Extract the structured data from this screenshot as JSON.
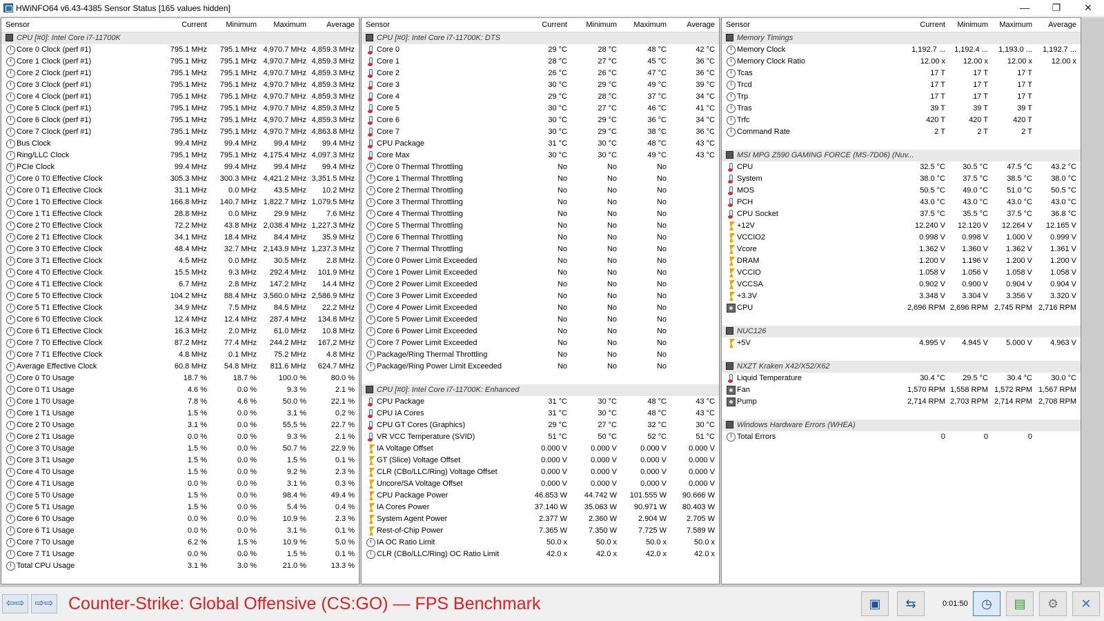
{
  "window": {
    "title": "HWiNFO64 v6.43-4385 Sensor Status [165 values hidden]",
    "min": "—",
    "max": "❐",
    "close": "✕"
  },
  "headers": {
    "sensor": "Sensor",
    "current": "Current",
    "minimum": "Minimum",
    "maximum": "Maximum",
    "average": "Average"
  },
  "pane1": [
    {
      "t": "g",
      "n": "CPU [#0]: Intel Core i7-11700K"
    },
    {
      "i": "clock",
      "n": "Core 0 Clock (perf #1)",
      "c": "795.1 MHz",
      "mi": "795.1 MHz",
      "ma": "4,970.7 MHz",
      "a": "4,859.3 MHz"
    },
    {
      "i": "clock",
      "n": "Core 1 Clock (perf #1)",
      "c": "795.1 MHz",
      "mi": "795.1 MHz",
      "ma": "4,970.7 MHz",
      "a": "4,859.3 MHz"
    },
    {
      "i": "clock",
      "n": "Core 2 Clock (perf #1)",
      "c": "795.1 MHz",
      "mi": "795.1 MHz",
      "ma": "4,970.7 MHz",
      "a": "4,859.3 MHz"
    },
    {
      "i": "clock",
      "n": "Core 3 Clock (perf #1)",
      "c": "795.1 MHz",
      "mi": "795.1 MHz",
      "ma": "4,970.7 MHz",
      "a": "4,859.3 MHz"
    },
    {
      "i": "clock",
      "n": "Core 4 Clock (perf #1)",
      "c": "795.1 MHz",
      "mi": "795.1 MHz",
      "ma": "4,970.7 MHz",
      "a": "4,859.3 MHz"
    },
    {
      "i": "clock",
      "n": "Core 5 Clock (perf #1)",
      "c": "795.1 MHz",
      "mi": "795.1 MHz",
      "ma": "4,970.7 MHz",
      "a": "4,859.3 MHz"
    },
    {
      "i": "clock",
      "n": "Core 6 Clock (perf #1)",
      "c": "795.1 MHz",
      "mi": "795.1 MHz",
      "ma": "4,970.7 MHz",
      "a": "4,859.3 MHz"
    },
    {
      "i": "clock",
      "n": "Core 7 Clock (perf #1)",
      "c": "795.1 MHz",
      "mi": "795.1 MHz",
      "ma": "4,970.7 MHz",
      "a": "4,863.8 MHz"
    },
    {
      "i": "clock",
      "n": "Bus Clock",
      "c": "99.4 MHz",
      "mi": "99.4 MHz",
      "ma": "99.4 MHz",
      "a": "99.4 MHz"
    },
    {
      "i": "clock",
      "n": "Ring/LLC Clock",
      "c": "795.1 MHz",
      "mi": "795.1 MHz",
      "ma": "4,175.4 MHz",
      "a": "4,097.3 MHz"
    },
    {
      "i": "clock",
      "n": "PCIe Clock",
      "c": "99.4 MHz",
      "mi": "99.4 MHz",
      "ma": "99.4 MHz",
      "a": "99.4 MHz"
    },
    {
      "i": "clock",
      "n": "Core 0 T0 Effective Clock",
      "c": "305.3 MHz",
      "mi": "300.3 MHz",
      "ma": "4,421.2 MHz",
      "a": "3,351.5 MHz"
    },
    {
      "i": "clock",
      "n": "Core 0 T1 Effective Clock",
      "c": "31.1 MHz",
      "mi": "0.0 MHz",
      "ma": "43.5 MHz",
      "a": "10.2 MHz"
    },
    {
      "i": "clock",
      "n": "Core 1 T0 Effective Clock",
      "c": "166.8 MHz",
      "mi": "140.7 MHz",
      "ma": "1,822.7 MHz",
      "a": "1,079.5 MHz"
    },
    {
      "i": "clock",
      "n": "Core 1 T1 Effective Clock",
      "c": "28.8 MHz",
      "mi": "0.0 MHz",
      "ma": "29.9 MHz",
      "a": "7.6 MHz"
    },
    {
      "i": "clock",
      "n": "Core 2 T0 Effective Clock",
      "c": "72.2 MHz",
      "mi": "43.8 MHz",
      "ma": "2,038.4 MHz",
      "a": "1,227.3 MHz"
    },
    {
      "i": "clock",
      "n": "Core 2 T1 Effective Clock",
      "c": "34.1 MHz",
      "mi": "18.4 MHz",
      "ma": "84.4 MHz",
      "a": "35.9 MHz"
    },
    {
      "i": "clock",
      "n": "Core 3 T0 Effective Clock",
      "c": "48.4 MHz",
      "mi": "32.7 MHz",
      "ma": "2,143.9 MHz",
      "a": "1,237.3 MHz"
    },
    {
      "i": "clock",
      "n": "Core 3 T1 Effective Clock",
      "c": "4.5 MHz",
      "mi": "0.0 MHz",
      "ma": "30.5 MHz",
      "a": "2.8 MHz"
    },
    {
      "i": "clock",
      "n": "Core 4 T0 Effective Clock",
      "c": "15.5 MHz",
      "mi": "9.3 MHz",
      "ma": "292.4 MHz",
      "a": "101.9 MHz"
    },
    {
      "i": "clock",
      "n": "Core 4 T1 Effective Clock",
      "c": "6.7 MHz",
      "mi": "2.8 MHz",
      "ma": "147.2 MHz",
      "a": "14.4 MHz"
    },
    {
      "i": "clock",
      "n": "Core 5 T0 Effective Clock",
      "c": "104.2 MHz",
      "mi": "88.4 MHz",
      "ma": "3,560.0 MHz",
      "a": "2,586.9 MHz"
    },
    {
      "i": "clock",
      "n": "Core 5 T1 Effective Clock",
      "c": "34.9 MHz",
      "mi": "7.5 MHz",
      "ma": "84.5 MHz",
      "a": "22.2 MHz"
    },
    {
      "i": "clock",
      "n": "Core 6 T0 Effective Clock",
      "c": "12.4 MHz",
      "mi": "12.4 MHz",
      "ma": "287.4 MHz",
      "a": "134.8 MHz"
    },
    {
      "i": "clock",
      "n": "Core 6 T1 Effective Clock",
      "c": "16.3 MHz",
      "mi": "2.0 MHz",
      "ma": "61.0 MHz",
      "a": "10.8 MHz"
    },
    {
      "i": "clock",
      "n": "Core 7 T0 Effective Clock",
      "c": "87.2 MHz",
      "mi": "77.4 MHz",
      "ma": "244.2 MHz",
      "a": "167.2 MHz"
    },
    {
      "i": "clock",
      "n": "Core 7 T1 Effective Clock",
      "c": "4.8 MHz",
      "mi": "0.1 MHz",
      "ma": "75.2 MHz",
      "a": "4.8 MHz"
    },
    {
      "i": "clock",
      "n": "Average Effective Clock",
      "c": "60.8 MHz",
      "mi": "54.8 MHz",
      "ma": "811.6 MHz",
      "a": "624.7 MHz"
    },
    {
      "i": "clock",
      "n": "Core 0 T0 Usage",
      "c": "18.7 %",
      "mi": "18.7 %",
      "ma": "100.0 %",
      "a": "80.0 %"
    },
    {
      "i": "clock",
      "n": "Core 0 T1 Usage",
      "c": "4.6 %",
      "mi": "0.0 %",
      "ma": "9.3 %",
      "a": "2.1 %"
    },
    {
      "i": "clock",
      "n": "Core 1 T0 Usage",
      "c": "7.8 %",
      "mi": "4.6 %",
      "ma": "50.0 %",
      "a": "22.1 %"
    },
    {
      "i": "clock",
      "n": "Core 1 T1 Usage",
      "c": "1.5 %",
      "mi": "0.0 %",
      "ma": "3.1 %",
      "a": "0.2 %"
    },
    {
      "i": "clock",
      "n": "Core 2 T0 Usage",
      "c": "3.1 %",
      "mi": "0.0 %",
      "ma": "55.5 %",
      "a": "22.7 %"
    },
    {
      "i": "clock",
      "n": "Core 2 T1 Usage",
      "c": "0.0 %",
      "mi": "0.0 %",
      "ma": "9.3 %",
      "a": "2.1 %"
    },
    {
      "i": "clock",
      "n": "Core 3 T0 Usage",
      "c": "1.5 %",
      "mi": "0.0 %",
      "ma": "50.7 %",
      "a": "22.9 %"
    },
    {
      "i": "clock",
      "n": "Core 3 T1 Usage",
      "c": "1.5 %",
      "mi": "0.0 %",
      "ma": "1.5 %",
      "a": "0.1 %"
    },
    {
      "i": "clock",
      "n": "Core 4 T0 Usage",
      "c": "1.5 %",
      "mi": "0.0 %",
      "ma": "9.2 %",
      "a": "2.3 %"
    },
    {
      "i": "clock",
      "n": "Core 4 T1 Usage",
      "c": "0.0 %",
      "mi": "0.0 %",
      "ma": "3.1 %",
      "a": "0.3 %"
    },
    {
      "i": "clock",
      "n": "Core 5 T0 Usage",
      "c": "1.5 %",
      "mi": "0.0 %",
      "ma": "98.4 %",
      "a": "49.4 %"
    },
    {
      "i": "clock",
      "n": "Core 5 T1 Usage",
      "c": "1.5 %",
      "mi": "0.0 %",
      "ma": "5.4 %",
      "a": "0.4 %"
    },
    {
      "i": "clock",
      "n": "Core 6 T0 Usage",
      "c": "0.0 %",
      "mi": "0.0 %",
      "ma": "10.9 %",
      "a": "2.3 %"
    },
    {
      "i": "clock",
      "n": "Core 6 T1 Usage",
      "c": "0.0 %",
      "mi": "0.0 %",
      "ma": "3.1 %",
      "a": "0.1 %"
    },
    {
      "i": "clock",
      "n": "Core 7 T0 Usage",
      "c": "6.2 %",
      "mi": "1.5 %",
      "ma": "10.9 %",
      "a": "5.0 %"
    },
    {
      "i": "clock",
      "n": "Core 7 T1 Usage",
      "c": "0.0 %",
      "mi": "0.0 %",
      "ma": "1.5 %",
      "a": "0.1 %"
    },
    {
      "i": "clock",
      "n": "Total CPU Usage",
      "c": "3.1 %",
      "mi": "3.0 %",
      "ma": "21.0 %",
      "a": "13.3 %"
    }
  ],
  "pane2": [
    {
      "t": "g",
      "n": "CPU [#0]: Intel Core i7-11700K: DTS"
    },
    {
      "i": "therm",
      "n": "Core 0",
      "c": "29 °C",
      "mi": "28 °C",
      "ma": "48 °C",
      "a": "42 °C"
    },
    {
      "i": "therm",
      "n": "Core 1",
      "c": "28 °C",
      "mi": "27 °C",
      "ma": "45 °C",
      "a": "36 °C"
    },
    {
      "i": "therm",
      "n": "Core 2",
      "c": "26 °C",
      "mi": "26 °C",
      "ma": "47 °C",
      "a": "36 °C"
    },
    {
      "i": "therm",
      "n": "Core 3",
      "c": "30 °C",
      "mi": "29 °C",
      "ma": "49 °C",
      "a": "39 °C"
    },
    {
      "i": "therm",
      "n": "Core 4",
      "c": "29 °C",
      "mi": "28 °C",
      "ma": "37 °C",
      "a": "34 °C"
    },
    {
      "i": "therm",
      "n": "Core 5",
      "c": "30 °C",
      "mi": "27 °C",
      "ma": "46 °C",
      "a": "41 °C"
    },
    {
      "i": "therm",
      "n": "Core 6",
      "c": "30 °C",
      "mi": "29 °C",
      "ma": "36 °C",
      "a": "34 °C"
    },
    {
      "i": "therm",
      "n": "Core 7",
      "c": "30 °C",
      "mi": "29 °C",
      "ma": "38 °C",
      "a": "36 °C"
    },
    {
      "i": "therm",
      "n": "CPU Package",
      "c": "31 °C",
      "mi": "30 °C",
      "ma": "48 °C",
      "a": "43 °C"
    },
    {
      "i": "therm",
      "n": "Core Max",
      "c": "30 °C",
      "mi": "30 °C",
      "ma": "49 °C",
      "a": "43 °C"
    },
    {
      "i": "clock",
      "n": "Core 0 Thermal Throttling",
      "c": "No",
      "mi": "No",
      "ma": "No",
      "a": ""
    },
    {
      "i": "clock",
      "n": "Core 1 Thermal Throttling",
      "c": "No",
      "mi": "No",
      "ma": "No",
      "a": ""
    },
    {
      "i": "clock",
      "n": "Core 2 Thermal Throttling",
      "c": "No",
      "mi": "No",
      "ma": "No",
      "a": ""
    },
    {
      "i": "clock",
      "n": "Core 3 Thermal Throttling",
      "c": "No",
      "mi": "No",
      "ma": "No",
      "a": ""
    },
    {
      "i": "clock",
      "n": "Core 4 Thermal Throttling",
      "c": "No",
      "mi": "No",
      "ma": "No",
      "a": ""
    },
    {
      "i": "clock",
      "n": "Core 5 Thermal Throttling",
      "c": "No",
      "mi": "No",
      "ma": "No",
      "a": ""
    },
    {
      "i": "clock",
      "n": "Core 6 Thermal Throttling",
      "c": "No",
      "mi": "No",
      "ma": "No",
      "a": ""
    },
    {
      "i": "clock",
      "n": "Core 7 Thermal Throttling",
      "c": "No",
      "mi": "No",
      "ma": "No",
      "a": ""
    },
    {
      "i": "clock",
      "n": "Core 0 Power Limit Exceeded",
      "c": "No",
      "mi": "No",
      "ma": "No",
      "a": ""
    },
    {
      "i": "clock",
      "n": "Core 1 Power Limit Exceeded",
      "c": "No",
      "mi": "No",
      "ma": "No",
      "a": ""
    },
    {
      "i": "clock",
      "n": "Core 2 Power Limit Exceeded",
      "c": "No",
      "mi": "No",
      "ma": "No",
      "a": ""
    },
    {
      "i": "clock",
      "n": "Core 3 Power Limit Exceeded",
      "c": "No",
      "mi": "No",
      "ma": "No",
      "a": ""
    },
    {
      "i": "clock",
      "n": "Core 4 Power Limit Exceeded",
      "c": "No",
      "mi": "No",
      "ma": "No",
      "a": ""
    },
    {
      "i": "clock",
      "n": "Core 5 Power Limit Exceeded",
      "c": "No",
      "mi": "No",
      "ma": "No",
      "a": ""
    },
    {
      "i": "clock",
      "n": "Core 6 Power Limit Exceeded",
      "c": "No",
      "mi": "No",
      "ma": "No",
      "a": ""
    },
    {
      "i": "clock",
      "n": "Core 7 Power Limit Exceeded",
      "c": "No",
      "mi": "No",
      "ma": "No",
      "a": ""
    },
    {
      "i": "clock",
      "n": "Package/Ring Thermal Throttling",
      "c": "No",
      "mi": "No",
      "ma": "No",
      "a": ""
    },
    {
      "i": "clock",
      "n": "Package/Ring Power Limit Exceeded",
      "c": "No",
      "mi": "No",
      "ma": "No",
      "a": ""
    },
    {
      "t": "s"
    },
    {
      "t": "g",
      "n": "CPU [#0]: Intel Core i7-11700K: Enhanced"
    },
    {
      "i": "therm",
      "n": "CPU Package",
      "c": "31 °C",
      "mi": "30 °C",
      "ma": "48 °C",
      "a": "43 °C"
    },
    {
      "i": "therm",
      "n": "CPU IA Cores",
      "c": "31 °C",
      "mi": "30 °C",
      "ma": "48 °C",
      "a": "43 °C"
    },
    {
      "i": "therm",
      "n": "CPU GT Cores (Graphics)",
      "c": "29 °C",
      "mi": "27 °C",
      "ma": "32 °C",
      "a": "30 °C"
    },
    {
      "i": "therm",
      "n": "VR VCC Temperature (SVID)",
      "c": "51 °C",
      "mi": "50 °C",
      "ma": "52 °C",
      "a": "51 °C"
    },
    {
      "i": "volt",
      "n": "IA Voltage Offset",
      "c": "0.000 V",
      "mi": "0.000 V",
      "ma": "0.000 V",
      "a": "0.000 V"
    },
    {
      "i": "volt",
      "n": "GT (Slice) Voltage Offset",
      "c": "0.000 V",
      "mi": "0.000 V",
      "ma": "0.000 V",
      "a": "0.000 V"
    },
    {
      "i": "volt",
      "n": "CLR (CBo/LLC/Ring) Voltage Offset",
      "c": "0.000 V",
      "mi": "0.000 V",
      "ma": "0.000 V",
      "a": "0.000 V"
    },
    {
      "i": "volt",
      "n": "Uncore/SA Voltage Offset",
      "c": "0.000 V",
      "mi": "0.000 V",
      "ma": "0.000 V",
      "a": "0.000 V"
    },
    {
      "i": "volt",
      "n": "CPU Package Power",
      "c": "46.853 W",
      "mi": "44.742 W",
      "ma": "101.555 W",
      "a": "90.666 W"
    },
    {
      "i": "volt",
      "n": "IA Cores Power",
      "c": "37.140 W",
      "mi": "35.063 W",
      "ma": "90.971 W",
      "a": "80.403 W"
    },
    {
      "i": "volt",
      "n": "System Agent Power",
      "c": "2.377 W",
      "mi": "2.360 W",
      "ma": "2.904 W",
      "a": "2.705 W"
    },
    {
      "i": "volt",
      "n": "Rest-of-Chip Power",
      "c": "7.365 W",
      "mi": "7.350 W",
      "ma": "7.725 W",
      "a": "7.589 W"
    },
    {
      "i": "clock",
      "n": "IA OC Ratio Limit",
      "c": "50.0 x",
      "mi": "50.0 x",
      "ma": "50.0 x",
      "a": "50.0 x"
    },
    {
      "i": "clock",
      "n": "CLR (CBo/LLC/Ring) OC Ratio Limit",
      "c": "42.0 x",
      "mi": "42.0 x",
      "ma": "42.0 x",
      "a": "42.0 x"
    }
  ],
  "pane3": [
    {
      "t": "g",
      "n": "Memory Timings"
    },
    {
      "i": "clock",
      "n": "Memory Clock",
      "c": "1,192.7 ...",
      "mi": "1,192.4 ...",
      "ma": "1,193.0 ...",
      "a": "1,192.7 ..."
    },
    {
      "i": "clock",
      "n": "Memory Clock Ratio",
      "c": "12.00 x",
      "mi": "12.00 x",
      "ma": "12.00 x",
      "a": "12.00 x"
    },
    {
      "i": "clock",
      "n": "Tcas",
      "c": "17 T",
      "mi": "17 T",
      "ma": "17 T",
      "a": ""
    },
    {
      "i": "clock",
      "n": "Trcd",
      "c": "17 T",
      "mi": "17 T",
      "ma": "17 T",
      "a": ""
    },
    {
      "i": "clock",
      "n": "Trp",
      "c": "17 T",
      "mi": "17 T",
      "ma": "17 T",
      "a": ""
    },
    {
      "i": "clock",
      "n": "Tras",
      "c": "39 T",
      "mi": "39 T",
      "ma": "39 T",
      "a": ""
    },
    {
      "i": "clock",
      "n": "Trfc",
      "c": "420 T",
      "mi": "420 T",
      "ma": "420 T",
      "a": ""
    },
    {
      "i": "clock",
      "n": "Command Rate",
      "c": "2 T",
      "mi": "2 T",
      "ma": "2 T",
      "a": ""
    },
    {
      "t": "s"
    },
    {
      "t": "g",
      "n": "MSI MPG Z590 GAMING FORCE (MS-7D06) (Nuv..."
    },
    {
      "i": "therm",
      "n": "CPU",
      "c": "32.5 °C",
      "mi": "30.5 °C",
      "ma": "47.5 °C",
      "a": "43.2 °C"
    },
    {
      "i": "therm",
      "n": "System",
      "c": "38.0 °C",
      "mi": "37.5 °C",
      "ma": "38.5 °C",
      "a": "38.0 °C"
    },
    {
      "i": "therm",
      "n": "MOS",
      "c": "50.5 °C",
      "mi": "49.0 °C",
      "ma": "51.0 °C",
      "a": "50.5 °C"
    },
    {
      "i": "therm",
      "n": "PCH",
      "c": "43.0 °C",
      "mi": "43.0 °C",
      "ma": "43.0 °C",
      "a": "43.0 °C"
    },
    {
      "i": "therm",
      "n": "CPU Socket",
      "c": "37.5 °C",
      "mi": "35.5 °C",
      "ma": "37.5 °C",
      "a": "36.8 °C"
    },
    {
      "i": "volt",
      "n": "+12V",
      "c": "12.240 V",
      "mi": "12.120 V",
      "ma": "12.264 V",
      "a": "12.165 V"
    },
    {
      "i": "volt",
      "n": "VCCIO2",
      "c": "0.998 V",
      "mi": "0.998 V",
      "ma": "1.000 V",
      "a": "0.999 V"
    },
    {
      "i": "volt",
      "n": "Vcore",
      "c": "1.362 V",
      "mi": "1.360 V",
      "ma": "1.362 V",
      "a": "1.361 V"
    },
    {
      "i": "volt",
      "n": "DRAM",
      "c": "1.200 V",
      "mi": "1.196 V",
      "ma": "1.200 V",
      "a": "1.200 V"
    },
    {
      "i": "volt",
      "n": "VCCIO",
      "c": "1.058 V",
      "mi": "1.056 V",
      "ma": "1.058 V",
      "a": "1.058 V"
    },
    {
      "i": "volt",
      "n": "VCCSA",
      "c": "0.902 V",
      "mi": "0.900 V",
      "ma": "0.904 V",
      "a": "0.904 V"
    },
    {
      "i": "volt",
      "n": "+3.3V",
      "c": "3.348 V",
      "mi": "3.304 V",
      "ma": "3.356 V",
      "a": "3.320 V"
    },
    {
      "i": "fan",
      "n": "CPU",
      "c": "2,696 RPM",
      "mi": "2,696 RPM",
      "ma": "2,745 RPM",
      "a": "2,716 RPM"
    },
    {
      "t": "s"
    },
    {
      "t": "g",
      "n": "NUC126"
    },
    {
      "i": "volt",
      "n": "+5V",
      "c": "4.995 V",
      "mi": "4.945 V",
      "ma": "5.000 V",
      "a": "4.963 V"
    },
    {
      "t": "s"
    },
    {
      "t": "g",
      "n": "NXZT Kraken X42/X52/X62"
    },
    {
      "i": "therm",
      "n": "Liquid Temperature",
      "c": "30.4 °C",
      "mi": "29.5 °C",
      "ma": "30.4 °C",
      "a": "30.0 °C"
    },
    {
      "i": "fan",
      "n": "Fan",
      "c": "1,570 RPM",
      "mi": "1,558 RPM",
      "ma": "1,572 RPM",
      "a": "1,567 RPM"
    },
    {
      "i": "fan",
      "n": "Pump",
      "c": "2,714 RPM",
      "mi": "2,703 RPM",
      "ma": "2,714 RPM",
      "a": "2,708 RPM"
    },
    {
      "t": "s"
    },
    {
      "t": "g",
      "n": "Windows Hardware Errors (WHEA)"
    },
    {
      "i": "clock",
      "n": "Total Errors",
      "c": "0",
      "mi": "0",
      "ma": "0",
      "a": ""
    }
  ],
  "bottom": {
    "nav_left": "⇦⇨",
    "nav_right": "⇨⇨",
    "benchmark_title": "Counter-Strike: Global Offensive (CS:GO) — FPS Benchmark",
    "timer": "0:01:50"
  },
  "colors": {
    "accent": "#1f5fbf",
    "benchmark": "#e02020"
  }
}
